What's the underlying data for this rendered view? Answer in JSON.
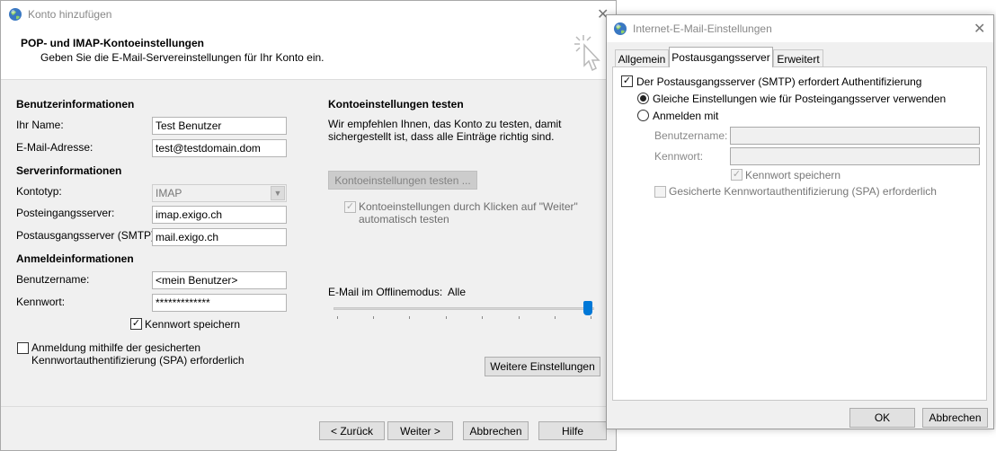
{
  "main_window": {
    "title": "Konto hinzufügen",
    "header_title": "POP- und IMAP-Kontoeinstellungen",
    "header_subtitle": "Geben Sie die E-Mail-Servereinstellungen für Ihr Konto ein.",
    "user_info": {
      "heading": "Benutzerinformationen",
      "name_label": "Ihr Name:",
      "name_value": "Test Benutzer",
      "email_label": "E-Mail-Adresse:",
      "email_value": "test@testdomain.dom"
    },
    "server_info": {
      "heading": "Serverinformationen",
      "account_type_label": "Kontotyp:",
      "account_type_value": "IMAP",
      "incoming_label": "Posteingangsserver:",
      "incoming_value": "imap.exigo.ch",
      "outgoing_label": "Postausgangsserver (SMTP):",
      "outgoing_value": "mail.exigo.ch"
    },
    "login_info": {
      "heading": "Anmeldeinformationen",
      "username_label": "Benutzername:",
      "username_value": "<mein Benutzer>",
      "password_label": "Kennwort:",
      "password_value": "*************",
      "remember_password_label": "Kennwort speichern",
      "remember_password_checked": true,
      "spa_label_line1": "Anmeldung mithilfe der gesicherten",
      "spa_label_line2": "Kennwortauthentifizierung (SPA) erforderlich",
      "spa_checked": false
    },
    "test_section": {
      "heading": "Kontoeinstellungen testen",
      "description_line1": "Wir empfehlen Ihnen, das Konto zu testen, damit",
      "description_line2": "sichergestellt ist, dass alle Einträge richtig sind.",
      "test_button": "Kontoeinstellungen testen ...",
      "auto_test_label_line1": "Kontoeinstellungen durch Klicken auf \"Weiter\"",
      "auto_test_label_line2": "automatisch testen",
      "auto_test_checked": true
    },
    "offline": {
      "label": "E-Mail im Offlinemodus:",
      "value": "Alle",
      "slider_fraction": 1.0
    },
    "more_settings_button": "Weitere Einstellungen",
    "buttons": {
      "back": "< Zurück",
      "next": "Weiter >",
      "cancel": "Abbrechen",
      "help": "Hilfe"
    }
  },
  "dialog": {
    "title": "Internet-E-Mail-Einstellungen",
    "tabs": [
      "Allgemein",
      "Postausgangsserver",
      "Erweitert"
    ],
    "active_tab": "Postausgangsserver",
    "smtp_auth_label": "Der Postausgangsserver (SMTP) erfordert Authentifizierung",
    "smtp_auth_checked": true,
    "same_settings_label": "Gleiche Einstellungen wie für Posteingangsserver verwenden",
    "login_with_label": "Anmelden mit",
    "selected_option": "same_settings",
    "username_label": "Benutzername:",
    "username_value": "",
    "password_label": "Kennwort:",
    "password_value": "",
    "remember_password_label": "Kennwort speichern",
    "remember_password_checked": true,
    "spa_label": "Gesicherte Kennwortauthentifizierung (SPA) erforderlich",
    "spa_checked": false,
    "ok_button": "OK",
    "cancel_button": "Abbrechen"
  },
  "icons": {
    "app_icon": "globe-icon",
    "close": "close-icon",
    "cursor": "click-cursor-icon",
    "check": "checkmark-icon",
    "dropdown": "chevron-down-icon"
  },
  "colors": {
    "accent": "#0078d7",
    "window_bg": "#f0f0f0",
    "header_bg": "#ffffff"
  }
}
